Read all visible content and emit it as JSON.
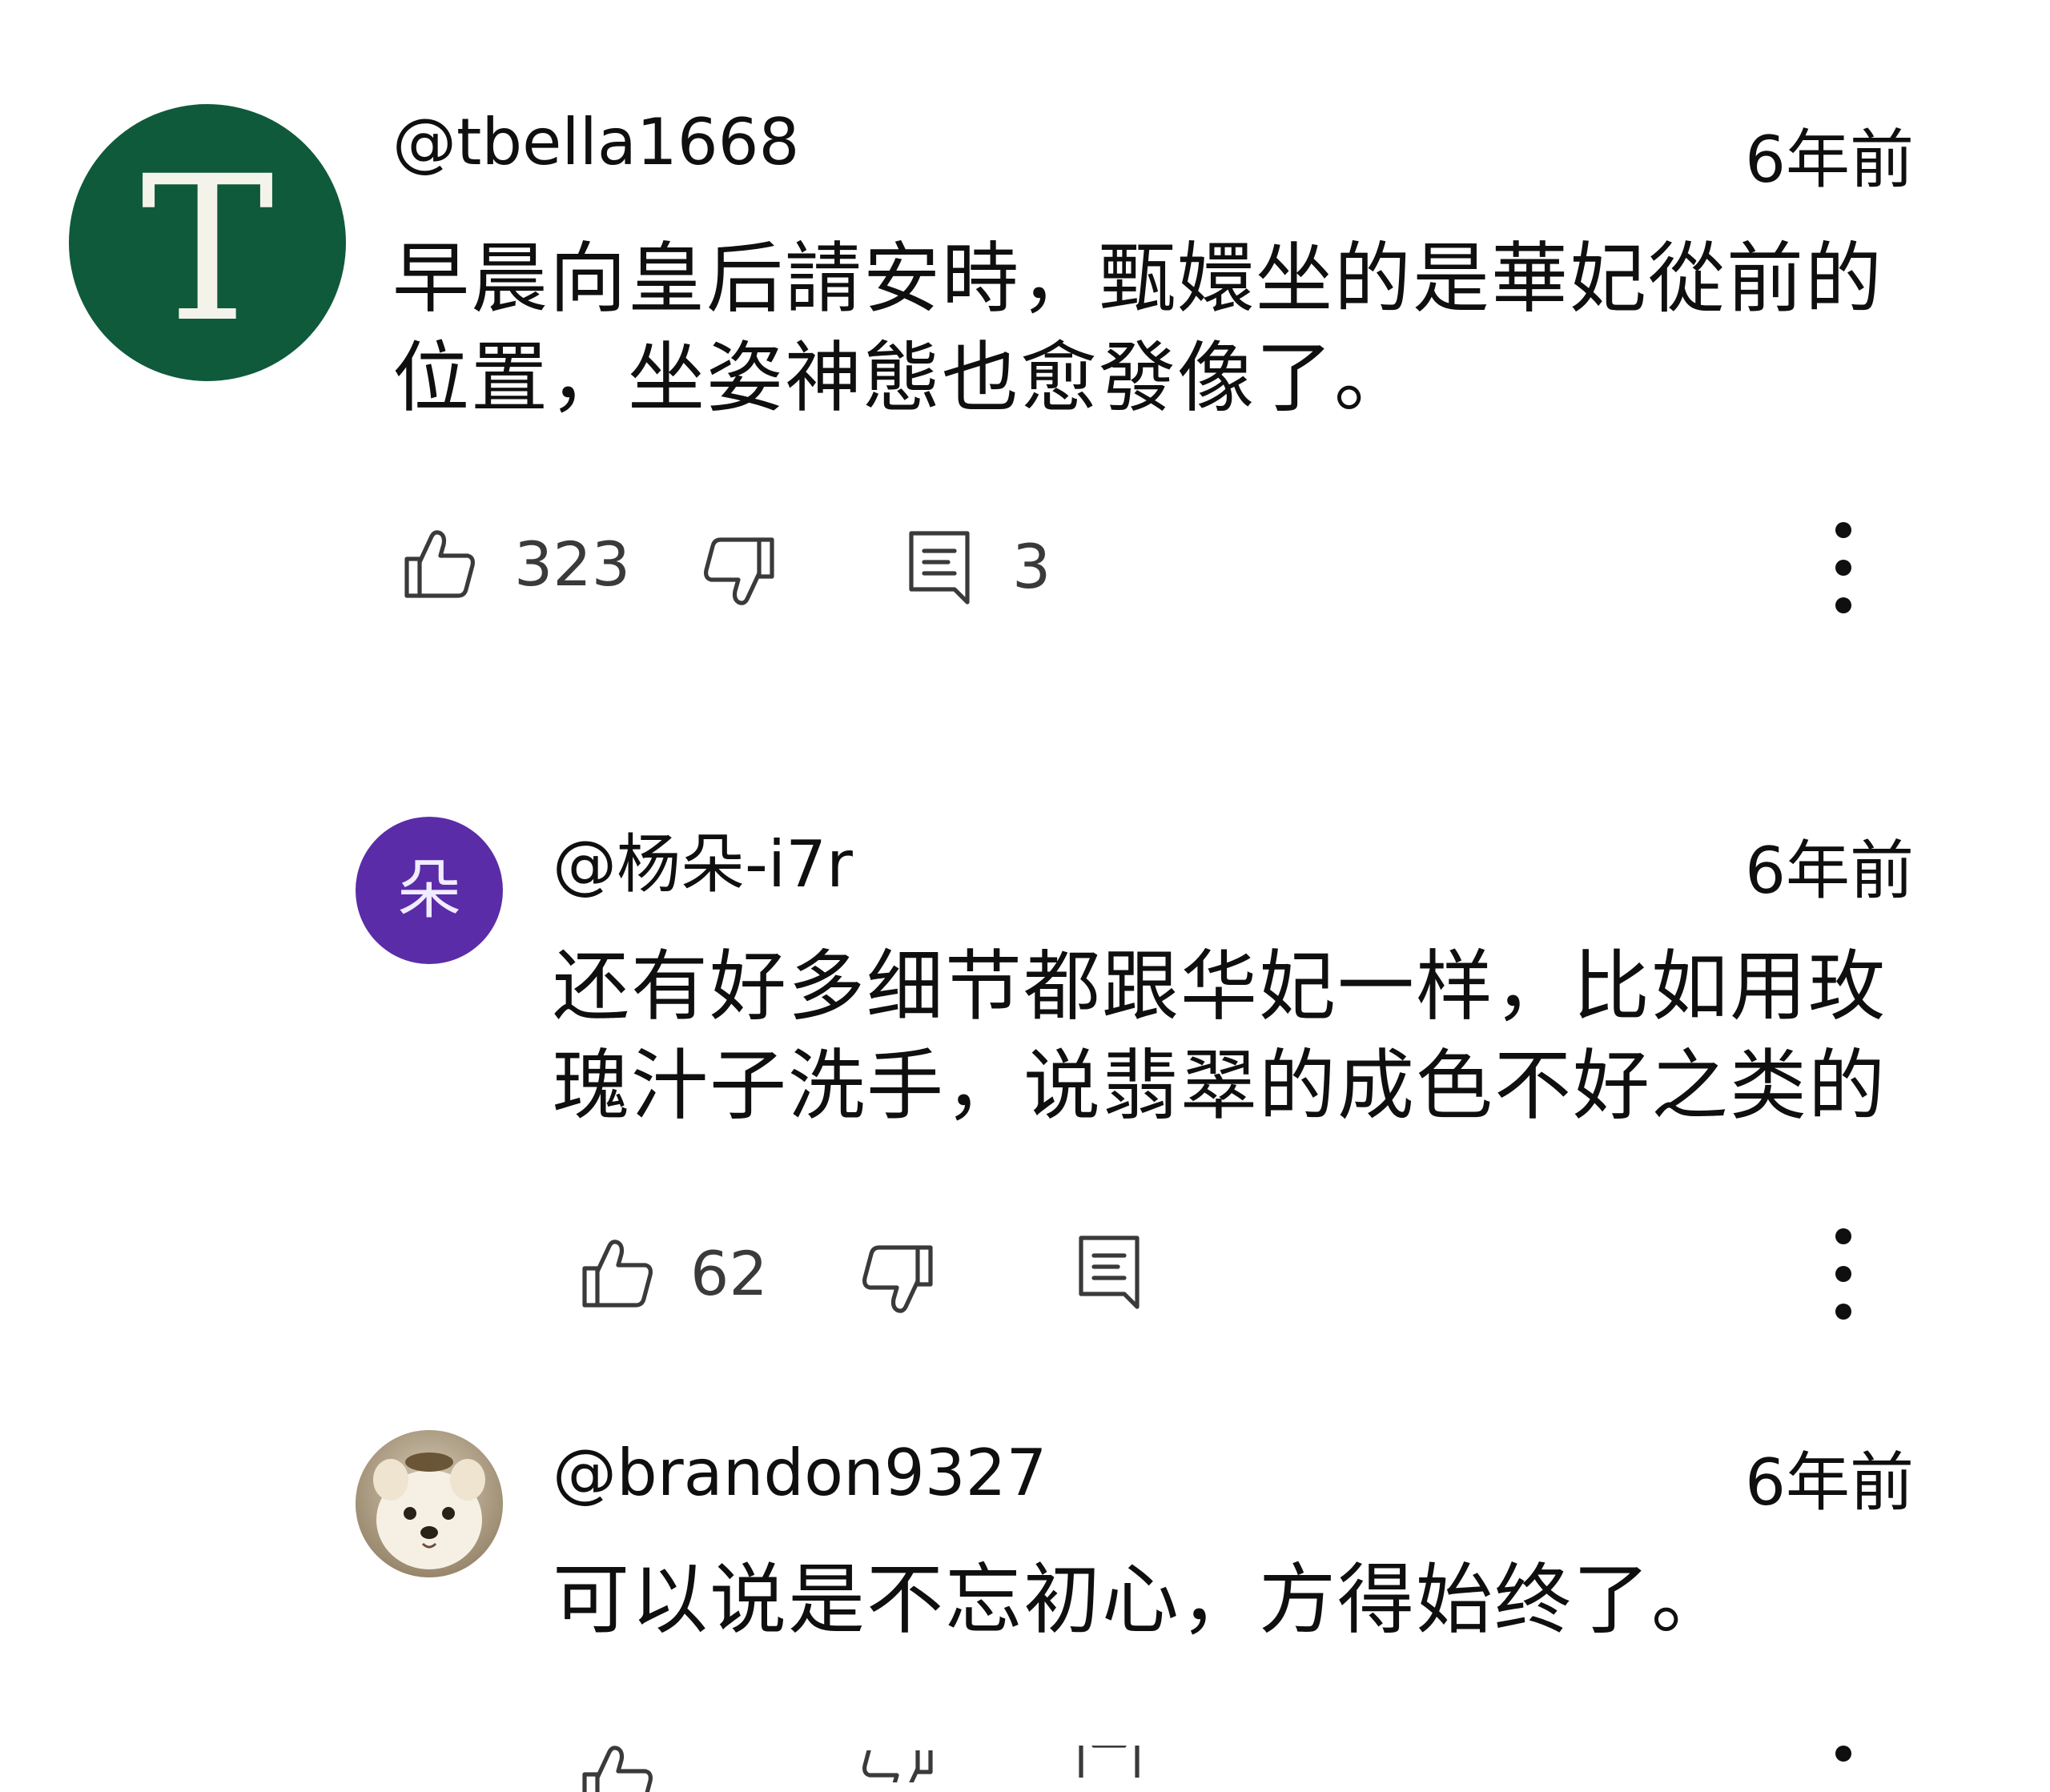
{
  "colors": {
    "avatar_t_bg": "#0f5a3b",
    "avatar_duo_bg": "#5a2ca8",
    "icon_stroke": "#3a3a3a",
    "text": "#0f0f0f"
  },
  "comments": [
    {
      "avatar_letter": "T",
      "username": "@tbella1668",
      "time": "6年前",
      "text_lines": [
        "早晨向皇后請安時，甄嬛坐的是華妃從前的",
        "位置，坐姿神態也愈發像了。"
      ],
      "likes": "323",
      "replies": "3",
      "icons": [
        "thumbs-up-icon",
        "thumbs-down-icon",
        "reply-icon",
        "more-vert-icon"
      ]
    },
    {
      "avatar_letter": "朵",
      "username": "@杨朵-i7r",
      "time": "6年前",
      "text_lines": [
        "还有好多细节都跟华妃一样，比如用玫",
        "瑰汁子洗手，说翡翠的成色不好之类的"
      ],
      "likes": "62",
      "replies": "",
      "icons": [
        "thumbs-up-icon",
        "thumbs-down-icon",
        "reply-icon",
        "more-vert-icon"
      ]
    },
    {
      "avatar_letter": "",
      "avatar_image": "dog-photo",
      "username": "@brandon9327",
      "time": "6年前",
      "text_lines": [
        "可以说是不忘初心，方得始终了。"
      ],
      "likes": "",
      "replies": "",
      "icons": [
        "thumbs-up-icon",
        "thumbs-down-icon",
        "reply-icon",
        "more-vert-icon"
      ]
    }
  ]
}
